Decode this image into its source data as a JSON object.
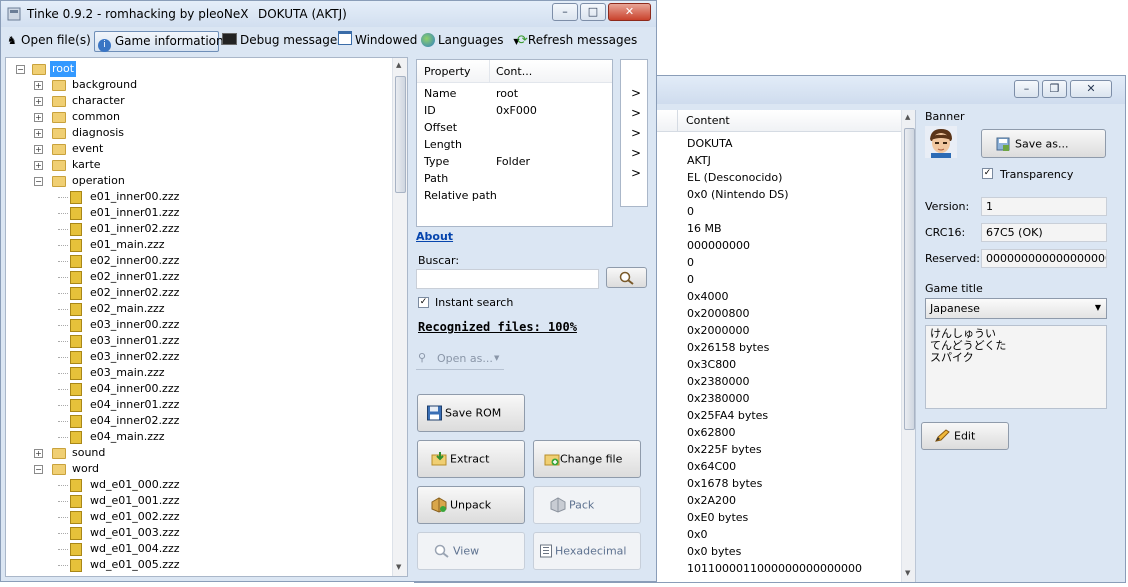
{
  "main_window": {
    "title": "Tinke 0.9.2 - romhacking by pleoNeX",
    "rom_title": "DOKUTA (AKTJ)",
    "toolbar": {
      "open_files": "Open file(s)",
      "game_information": "Game information",
      "debug_messages": "Debug messages",
      "windowed": "Windowed",
      "languages": "Languages",
      "refresh_messages": "Refresh messages"
    },
    "tree": {
      "root": "root",
      "folders_top": [
        "background",
        "character",
        "common",
        "diagnosis",
        "event",
        "karte"
      ],
      "operation": "operation",
      "operation_files": [
        "e01_inner00.zzz",
        "e01_inner01.zzz",
        "e01_inner02.zzz",
        "e01_main.zzz",
        "e02_inner00.zzz",
        "e02_inner01.zzz",
        "e02_inner02.zzz",
        "e02_main.zzz",
        "e03_inner00.zzz",
        "e03_inner01.zzz",
        "e03_inner02.zzz",
        "e03_main.zzz",
        "e04_inner00.zzz",
        "e04_inner01.zzz",
        "e04_inner02.zzz",
        "e04_main.zzz"
      ],
      "sound": "sound",
      "word": "word",
      "word_files": [
        "wd_e01_000.zzz",
        "wd_e01_001.zzz",
        "wd_e01_002.zzz",
        "wd_e01_003.zzz",
        "wd_e01_004.zzz",
        "wd_e01_005.zzz"
      ]
    },
    "properties": {
      "col_property": "Property",
      "col_content": "Cont...",
      "names": [
        "Name",
        "ID",
        "Offset",
        "Length",
        "Type",
        "Path",
        "Relative path"
      ],
      "values": [
        "root",
        "0xF000",
        "",
        "",
        "Folder",
        "",
        ""
      ]
    },
    "arrow_glyph": ">",
    "about": "About",
    "search_label": "Buscar:",
    "search_value": "",
    "instant_search": "Instant search",
    "recognized": "Recognized files: 100%",
    "open_as": "Open as...",
    "buttons": {
      "save_rom": "Save ROM",
      "extract": "Extract",
      "change_file": "Change file",
      "unpack": "Unpack",
      "pack": "Pack",
      "view": "View",
      "hexadecimal": "Hexadecimal"
    }
  },
  "info_window": {
    "column_content": "Content",
    "content": [
      "DOKUTA",
      "AKTJ",
      "EL (Desconocido)",
      "0x0 (Nintendo DS)",
      "0",
      "16 MB",
      "000000000",
      "0",
      "0",
      "0x4000",
      "0x2000800",
      "0x2000000",
      "0x26158 bytes",
      "0x3C800",
      "0x2380000",
      "0x2380000",
      "0x25FA4 bytes",
      "0x62800",
      "0x225F bytes",
      "0x64C00",
      "0x1678 bytes",
      "0x2A200",
      "0xE0 bytes",
      "0x0",
      "0x0 bytes",
      "1011000011000000000000000"
    ],
    "banner": {
      "group": "Banner",
      "save_as": "Save as...",
      "transparency": "Transparency",
      "version_label": "Version:",
      "version": "1",
      "crc_label": "CRC16:",
      "crc": "67C5 (OK)",
      "reserved_label": "Reserved:",
      "reserved": "0000000000000000000000",
      "game_title_label": "Game title",
      "language": "Japanese",
      "title_text": "けんしゅうい\nてんどうどくた\nスパイク",
      "edit": "Edit"
    }
  },
  "colors": {
    "window_bg": "#dbe6f3",
    "selection": "#3399ff",
    "link": "#0645ad"
  }
}
